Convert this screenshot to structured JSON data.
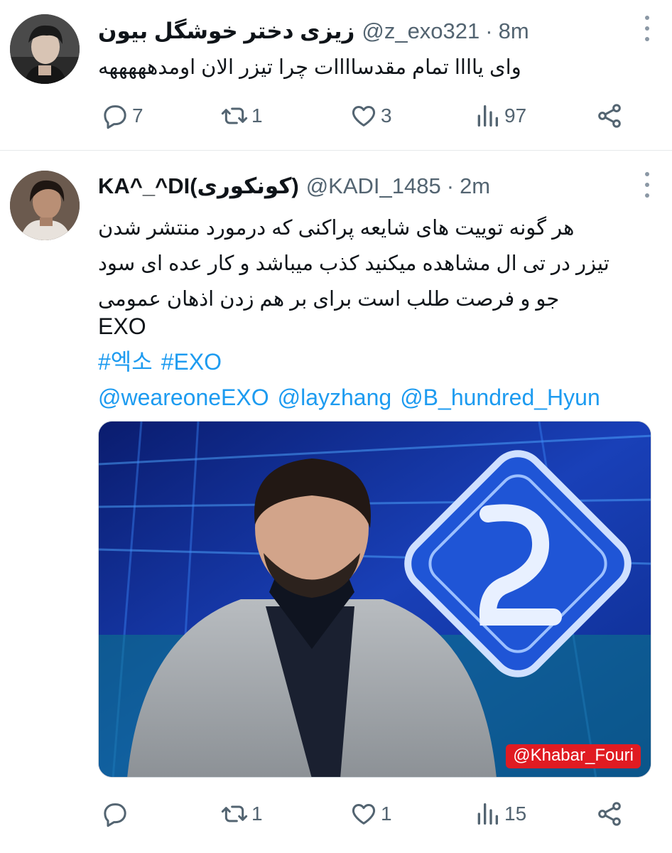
{
  "tweets": [
    {
      "display_name": "زیزی دختر خوشگل بیون",
      "handle": "@z_exo321",
      "separator": "·",
      "time": "8m",
      "text": "وای یاااا تمام مقدساااات چرا تیزر الان اومدهههههه",
      "replies": "7",
      "retweets": "1",
      "likes": "3",
      "views": "97"
    },
    {
      "display_name": "KA^_^DI(کونکوری)",
      "handle": "@KADI_1485",
      "separator": "·",
      "time": "2m",
      "text_lines": [
        "هر گونه توییت های شایعه پراکنی که درمورد منتشر شدن",
        "تیزر در تی ال مشاهده میکنید کذب میباشد و کار عده ای سود",
        "جو و فرصت طلب است برای بر هم زدن اذهان عمومی"
      ],
      "exo_line": "EXO",
      "hashtags": [
        "#엑소",
        "#EXO"
      ],
      "mentions": [
        "@weareoneEXO",
        "@layzhang",
        "@B_hundred_Hyun"
      ],
      "media_watermark": "@Khabar_Fouri",
      "replies": "",
      "retweets": "1",
      "likes": "1",
      "views": "15"
    }
  ],
  "colors": {
    "link": "#1d9bf0",
    "secondary_text": "#536471",
    "primary_text": "#0f1419",
    "watermark_bg": "#e01b22"
  },
  "icons": [
    "reply-icon",
    "retweet-icon",
    "like-icon",
    "views-icon",
    "share-icon",
    "more-icon"
  ]
}
